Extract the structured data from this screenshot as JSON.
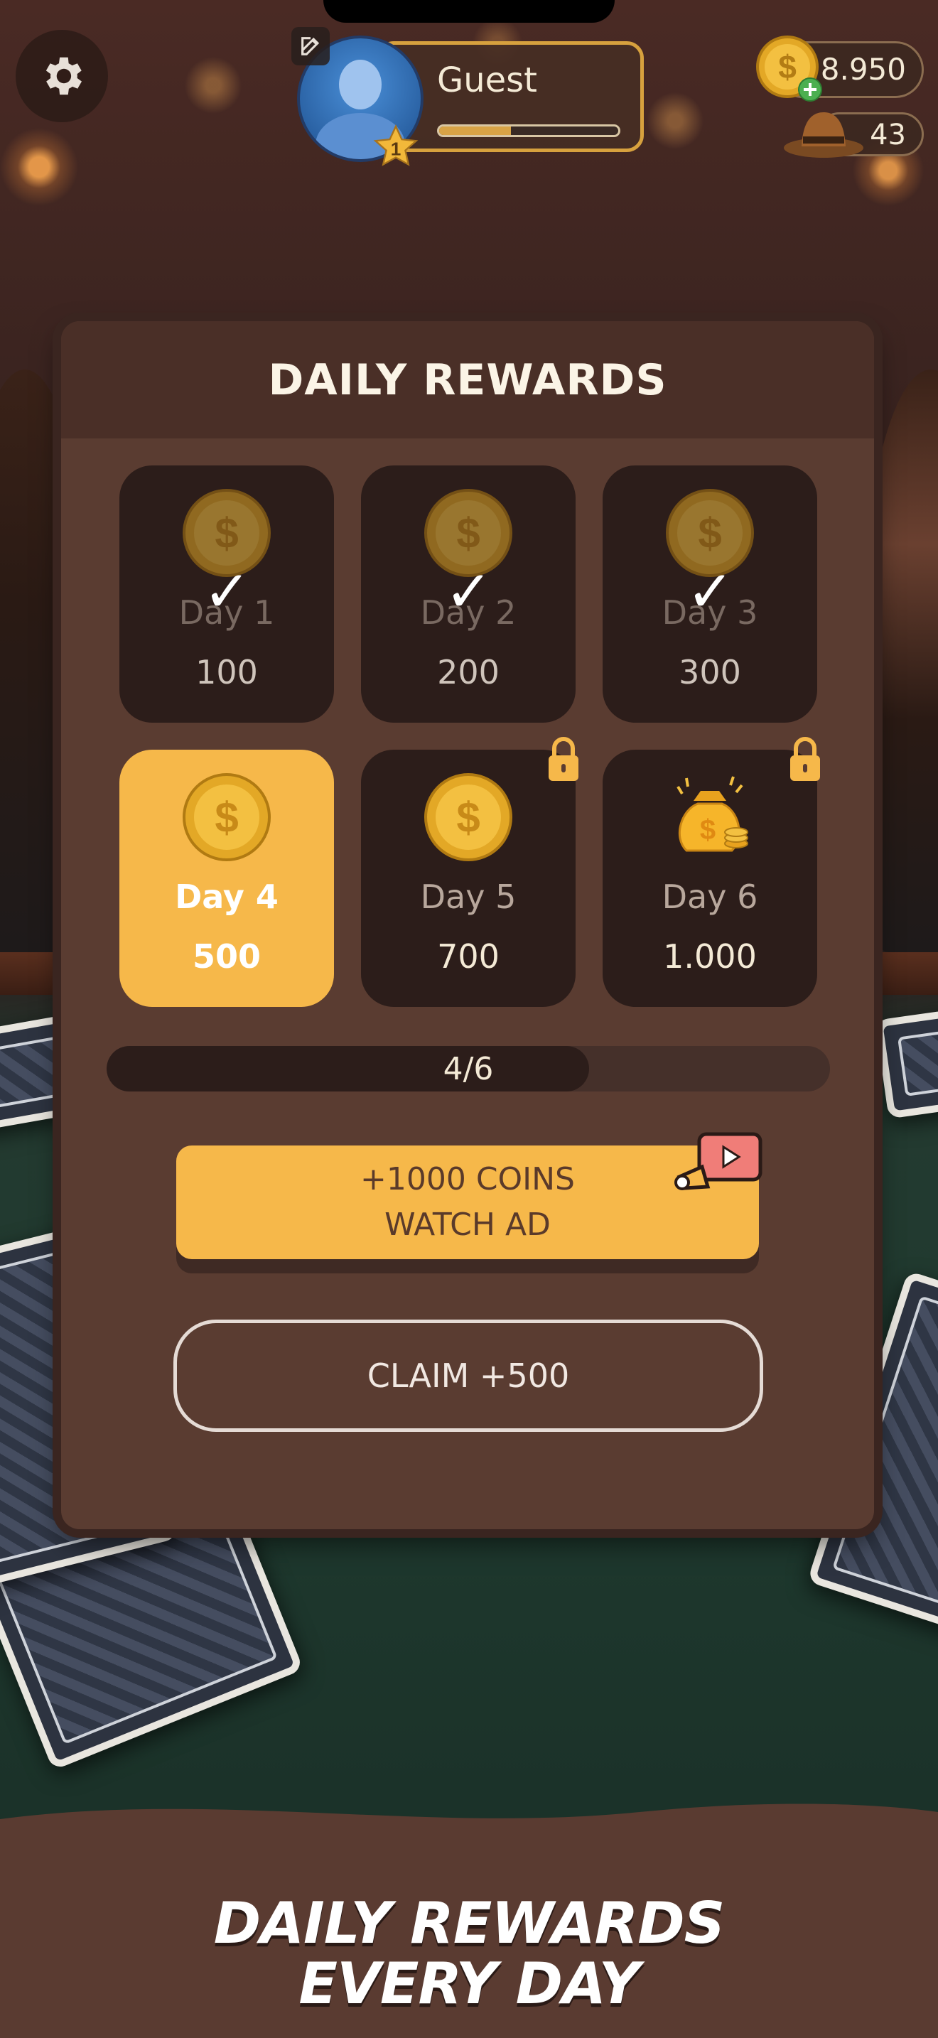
{
  "hud": {
    "player_name": "Guest",
    "level": "1",
    "xp_progress": 0.4,
    "coins": "8.950",
    "hats": "43"
  },
  "modal": {
    "title": "DAILY REWARDS",
    "rewards": [
      {
        "day": "Day 1",
        "amount": "100",
        "state": "claimed",
        "icon": "coin-icon",
        "check": "✓"
      },
      {
        "day": "Day 2",
        "amount": "200",
        "state": "claimed",
        "icon": "coin-icon",
        "check": "✓"
      },
      {
        "day": "Day 3",
        "amount": "300",
        "state": "claimed",
        "icon": "coin-icon",
        "check": "✓"
      },
      {
        "day": "Day 4",
        "amount": "500",
        "state": "current",
        "icon": "coin-icon"
      },
      {
        "day": "Day 5",
        "amount": "700",
        "state": "locked",
        "icon": "coin-icon"
      },
      {
        "day": "Day 6",
        "amount": "1.000",
        "state": "locked",
        "icon": "money-bag-icon"
      }
    ],
    "progress_label": "4/6",
    "progress_fraction": 0.6667,
    "watch_ad_line1": "+1000 COINS",
    "watch_ad_line2": "WATCH AD",
    "claim_label": "CLAIM +500"
  },
  "footer": {
    "line1": "DAILY REWARDS",
    "line2": "EVERY DAY"
  },
  "colors": {
    "accent": "#f6b84a",
    "modal_bg": "#5a3c31",
    "tile_bg": "#2c1d1a"
  }
}
